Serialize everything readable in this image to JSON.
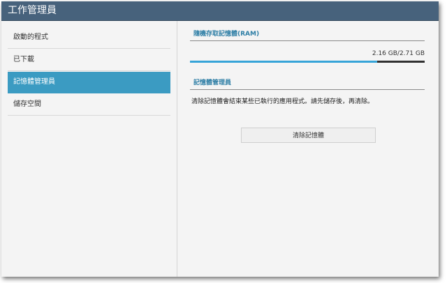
{
  "window": {
    "title": "工作管理員"
  },
  "sidebar": {
    "items": [
      {
        "label": "啟動的程式"
      },
      {
        "label": "已下載"
      },
      {
        "label": "記憶體管理員"
      },
      {
        "label": "儲存空間"
      }
    ]
  },
  "ram": {
    "header": "隨機存取記憶體(RAM)",
    "usage_text": "2.16 GB/2.71 GB",
    "used_fraction": 0.797
  },
  "memory_manager": {
    "header": "記憶體管理員",
    "description": "清除記憶體會結束某些已執行的應用程式。請先儲存後，再清除。",
    "clear_button_label": "清除記憶體"
  }
}
